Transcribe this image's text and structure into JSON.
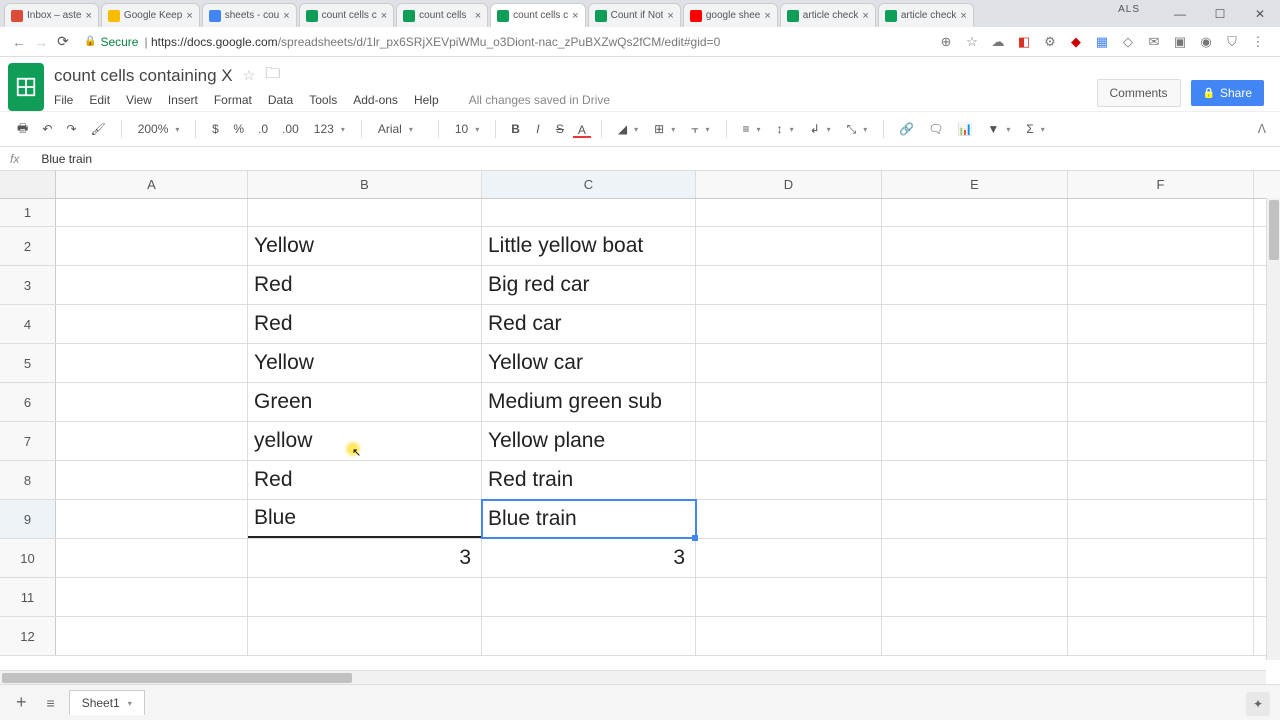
{
  "browser": {
    "tabs": [
      {
        "label": "Inbox – aste",
        "favicon": "#dd4b39"
      },
      {
        "label": "Google Keep",
        "favicon": "#fbbc04"
      },
      {
        "label": "sheets - cou",
        "favicon": "#4285f4"
      },
      {
        "label": "count cells c",
        "favicon": "#0f9d58"
      },
      {
        "label": "count cells",
        "favicon": "#0f9d58"
      },
      {
        "label": "count cells c",
        "favicon": "#0f9d58",
        "active": true
      },
      {
        "label": "Count if Not",
        "favicon": "#0f9d58"
      },
      {
        "label": "google shee",
        "favicon": "#ff0000"
      },
      {
        "label": "article check",
        "favicon": "#0f9d58"
      },
      {
        "label": "article check",
        "favicon": "#0f9d58"
      }
    ],
    "user": "ALS",
    "url_secure": "Secure",
    "url_domain": "https://docs.google.com",
    "url_path": "/spreadsheets/d/1lr_px6SRjXEVpiWMu_o3Diont-nac_zPuBXZwQs2fCM/edit#gid=0"
  },
  "doc": {
    "title": "count cells containing X",
    "menus": [
      "File",
      "Edit",
      "View",
      "Insert",
      "Format",
      "Data",
      "Tools",
      "Add-ons",
      "Help"
    ],
    "saved": "All changes saved in Drive",
    "comments": "Comments",
    "share": "Share"
  },
  "toolbar": {
    "zoom": "200%",
    "font": "Arial",
    "size": "10",
    "numfmt": "123"
  },
  "formula": {
    "fx": "fx",
    "value": "Blue train"
  },
  "grid": {
    "cols": [
      "A",
      "B",
      "C",
      "D",
      "E",
      "F"
    ],
    "rows": [
      "1",
      "2",
      "3",
      "4",
      "5",
      "6",
      "7",
      "8",
      "9",
      "10",
      "11",
      "12"
    ],
    "data": {
      "B2": "Yellow",
      "C2": "Little yellow boat",
      "B3": "Red",
      "C3": "Big red car",
      "B4": "Red",
      "C4": "Red car",
      "B5": "Yellow",
      "C5": "Yellow car",
      "B6": "Green",
      "C6": "Medium green sub",
      "B7": "yellow",
      "C7": "Yellow plane",
      "B8": "Red",
      "C8": "Red train",
      "B9": "Blue",
      "C9": "Blue train",
      "B10": "3",
      "C10": "3"
    },
    "selected": "C9"
  },
  "sheetbar": {
    "tab": "Sheet1"
  }
}
